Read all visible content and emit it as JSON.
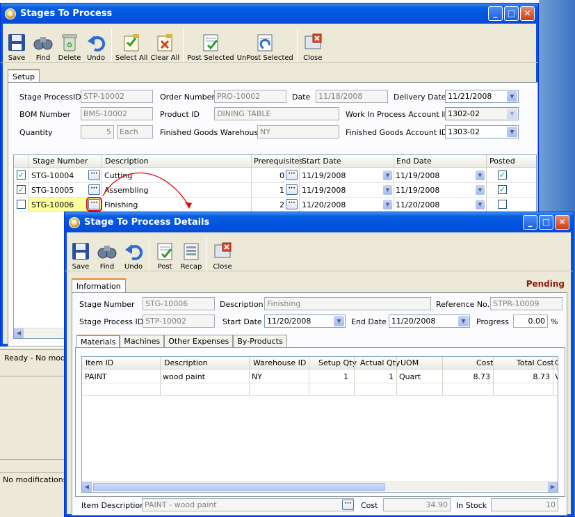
{
  "background": {
    "status1": "Ready - No modifications",
    "status2": "No modifications made"
  },
  "main_window": {
    "title": "Stages To Process",
    "toolbar": [
      {
        "label": "Save",
        "icon": "save-icon"
      },
      {
        "label": "Find",
        "icon": "binoculars-icon"
      },
      {
        "label": "Delete",
        "icon": "recycle-bin-icon"
      },
      {
        "label": "Undo",
        "icon": "undo-icon"
      },
      {
        "label": "Select All",
        "icon": "select-all-icon"
      },
      {
        "label": "Clear All",
        "icon": "clear-all-icon"
      },
      {
        "label": "Post Selected",
        "icon": "post-icon"
      },
      {
        "label": "UnPost Selected",
        "icon": "unpost-icon"
      },
      {
        "label": "Close",
        "icon": "close-door-icon"
      }
    ],
    "tab": "Setup",
    "form": {
      "stage_process_id_label": "Stage ProcessID",
      "stage_process_id": "STP-10002",
      "order_number_label": "Order Number",
      "order_number": "PRO-10002",
      "date_label": "Date",
      "date": "11/18/2008",
      "delivery_date_label": "Delivery Date",
      "delivery_date": "11/21/2008",
      "bom_number_label": "BOM Number",
      "bom_number": "BMS-10002",
      "product_id_label": "Product ID",
      "product_id": "DINING TABLE",
      "wip_account_label": "Work In Process Account ID",
      "wip_account": "1302-02",
      "quantity_label": "Quantity",
      "quantity": "5",
      "uom": "Each",
      "fg_warehouse_label": "Finished Goods Warehouse",
      "fg_warehouse": "NY",
      "fg_account_label": "Finished Goods Account ID",
      "fg_account": "1303-02"
    },
    "grid": {
      "headers": [
        "Stage Number",
        "Description",
        "Prerequisites",
        "Start Date",
        "End Date",
        "Posted"
      ],
      "rows": [
        {
          "selected": true,
          "stage": "STG-10004",
          "desc": "Cutting",
          "prereq": "0",
          "start": "11/19/2008",
          "end": "11/19/2008",
          "posted": true
        },
        {
          "selected": true,
          "stage": "STG-10005",
          "desc": "Assembling",
          "prereq": "1",
          "start": "11/19/2008",
          "end": "11/19/2008",
          "posted": true
        },
        {
          "selected": false,
          "stage": "STG-10006",
          "desc": "Finishing",
          "prereq": "2",
          "start": "11/20/2008",
          "end": "11/20/2008",
          "posted": false
        }
      ]
    }
  },
  "detail_window": {
    "title": "Stage To Process Details",
    "toolbar": [
      {
        "label": "Save",
        "icon": "save-icon"
      },
      {
        "label": "Find",
        "icon": "binoculars-icon"
      },
      {
        "label": "Undo",
        "icon": "undo-icon"
      },
      {
        "label": "Post",
        "icon": "post-icon"
      },
      {
        "label": "Recap",
        "icon": "recap-icon"
      },
      {
        "label": "Close",
        "icon": "close-door-icon"
      }
    ],
    "tab": "Information",
    "status": "Pending",
    "form": {
      "stage_number_label": "Stage Number",
      "stage_number": "STG-10006",
      "description_label": "Description",
      "description": "Finishing",
      "reference_label": "Reference No.",
      "reference": "STPR-10009",
      "stage_process_id_label": "Stage Process ID",
      "stage_process_id": "STP-10002",
      "start_date_label": "Start Date",
      "start_date": "11/20/2008",
      "end_date_label": "End Date",
      "end_date": "11/20/2008",
      "progress_label": "Progress",
      "progress": "0.00",
      "progress_unit": "%"
    },
    "subtabs": [
      "Materials",
      "Machines",
      "Other Expenses",
      "By-Products"
    ],
    "materials": {
      "headers": [
        "Item ID",
        "Description",
        "Warehouse ID",
        "Setup Qty",
        "Actual Qty",
        "UOM",
        "Cost",
        "Total Cost",
        "C"
      ],
      "rows": [
        {
          "item": "PAINT",
          "desc": "wood paint",
          "wh": "NY",
          "setup": "1",
          "actual": "1",
          "uom": "Quart",
          "cost": "8.73",
          "total": "8.73",
          "c": "V"
        }
      ]
    },
    "footer": {
      "item_desc_label": "Item Description",
      "item_desc": "PAINT - wood paint",
      "cost_label": "Cost",
      "cost": "34.90",
      "in_stock_label": "In Stock",
      "in_stock": "10"
    }
  }
}
